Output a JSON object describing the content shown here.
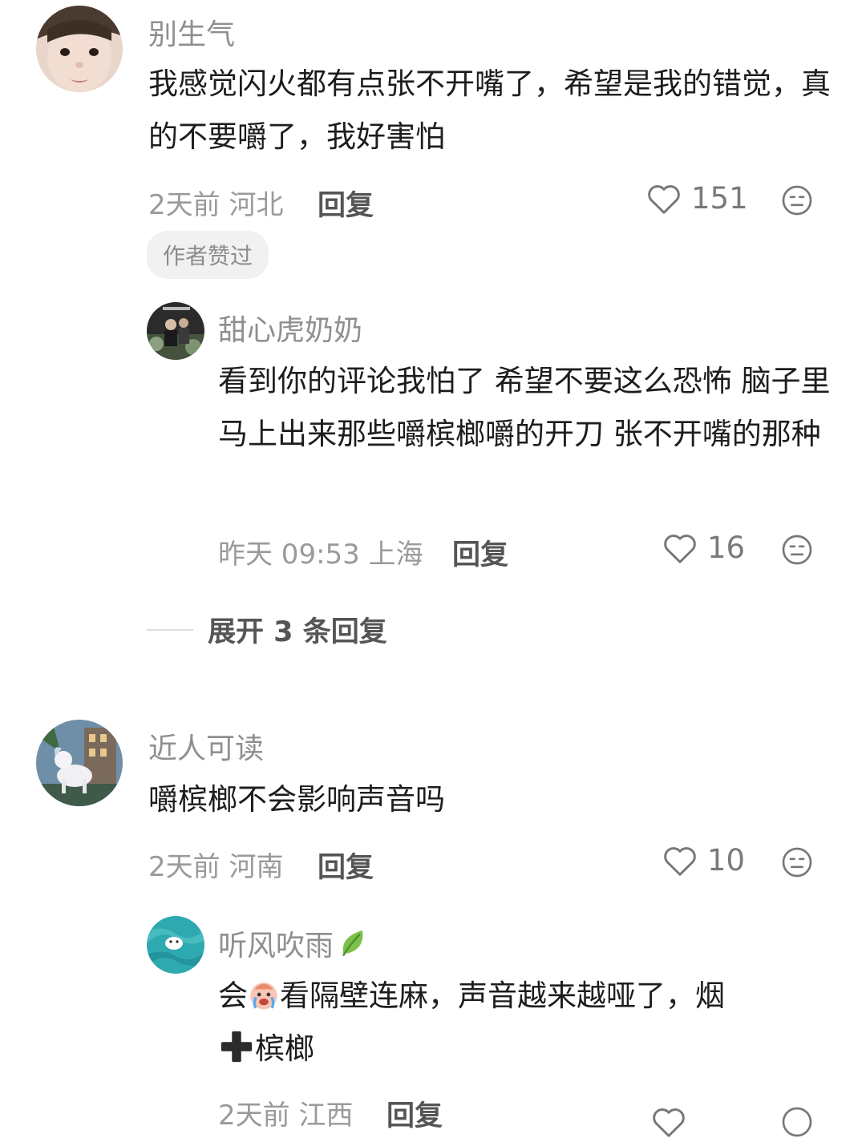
{
  "comments": [
    {
      "username": "别生气",
      "text": "我感觉闪火都有点张不开嘴了，希望是我的错觉，真的不要嚼了，我好害怕",
      "time": "2天前",
      "location": "河北",
      "reply_label": "回复",
      "likes": "151",
      "badge": "作者赞过",
      "replies": [
        {
          "username": "甜心虎奶奶",
          "text": "看到你的评论我怕了 希望不要这么恐怖 脑子里马上出来那些嚼槟榔嚼的开刀 张不开嘴的那种",
          "time": "昨天 09:53",
          "location": "上海",
          "reply_label": "回复",
          "likes": "16"
        }
      ],
      "expand_label": "展开 3 条回复"
    },
    {
      "username": "近人可读",
      "text": "嚼槟榔不会影响声音吗",
      "time": "2天前",
      "location": "河南",
      "reply_label": "回复",
      "likes": "10",
      "replies": [
        {
          "username": "听风吹雨",
          "text_part1": "会",
          "text_part2": "看隔壁连麻，声音越来越哑了，烟",
          "text_part3": "槟榔",
          "time": "2天前",
          "location": "江西",
          "reply_label": "回复"
        }
      ]
    }
  ],
  "icons": {
    "like": "heart-outline-icon",
    "dislike": "meh-face-icon",
    "leaf": "leaf-icon",
    "crying": "crying-face-emoji",
    "plus": "heavy-plus-emoji"
  }
}
